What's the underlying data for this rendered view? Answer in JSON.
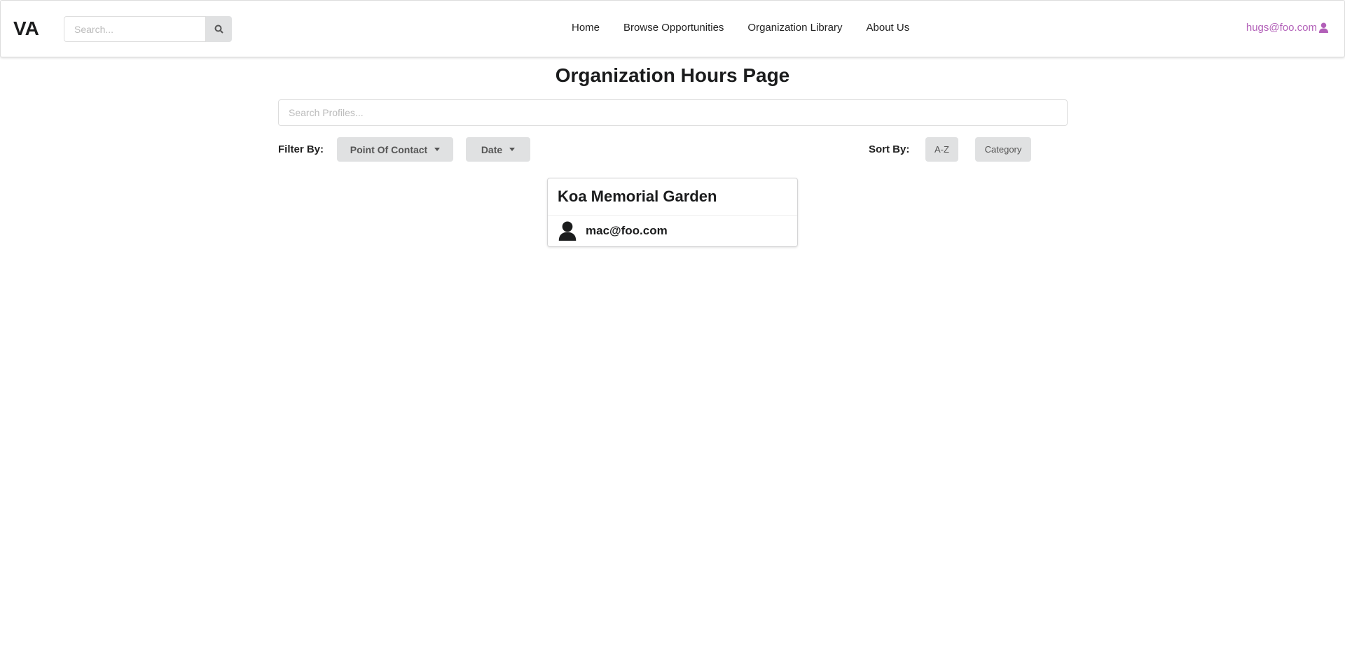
{
  "nav": {
    "logo": "VA",
    "search_placeholder": "Search...",
    "links": [
      "Home",
      "Browse Opportunities",
      "Organization Library",
      "About Us"
    ],
    "user": "hugs@foo.com"
  },
  "page": {
    "title": "Organization Hours Page",
    "search_placeholder": "Search Profiles...",
    "filter_label": "Filter By:",
    "filters": [
      "Point Of Contact",
      "Date"
    ],
    "sort_label": "Sort By:",
    "sorts": [
      "A-Z",
      "Category"
    ]
  },
  "cards": [
    {
      "name": "Koa Memorial Garden",
      "contact": "mac@foo.com"
    }
  ],
  "colors": {
    "user": "#b25fb8",
    "button": "#e0e1e2"
  }
}
